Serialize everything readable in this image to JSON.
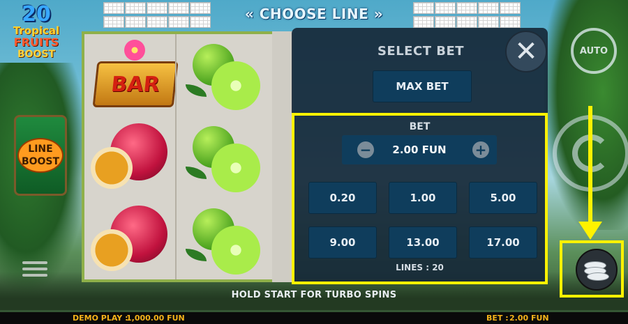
{
  "header": {
    "choose_line": "« CHOOSE LINE »"
  },
  "logo": {
    "number": "20",
    "line1": "Tropical",
    "line2": "FRUITS",
    "line3": "BOOST"
  },
  "line_boost": {
    "line1": "LINE",
    "line2": "BOOST"
  },
  "reels": {
    "bar_label": "BAR"
  },
  "select_bet": {
    "title": "SELECT BET",
    "close_glyph": "✕",
    "max_bet": "MAX BET",
    "bet_label": "BET",
    "current_bet": "2.00 FUN",
    "minus": "−",
    "plus": "+",
    "options": [
      "0.20",
      "1.00",
      "5.00",
      "9.00",
      "13.00",
      "17.00"
    ],
    "lines": "LINES : 20"
  },
  "controls": {
    "auto": "AUTO"
  },
  "hint": "HOLD START FOR TURBO SPINS",
  "footer": {
    "demo_label": "DEMO PLAY :",
    "demo_value": "1,000.00 FUN",
    "bet_label": "BET :",
    "bet_value": "2.00 FUN"
  },
  "colors": {
    "highlight": "#fff200",
    "panel": "#162838",
    "button": "#0f3d5c",
    "footer_text": "#f5b21a"
  },
  "icons": [
    "close-icon",
    "minus-icon",
    "plus-icon",
    "auto-icon",
    "spin-icon",
    "coins-icon",
    "menu-icon",
    "arrow-down-icon"
  ]
}
